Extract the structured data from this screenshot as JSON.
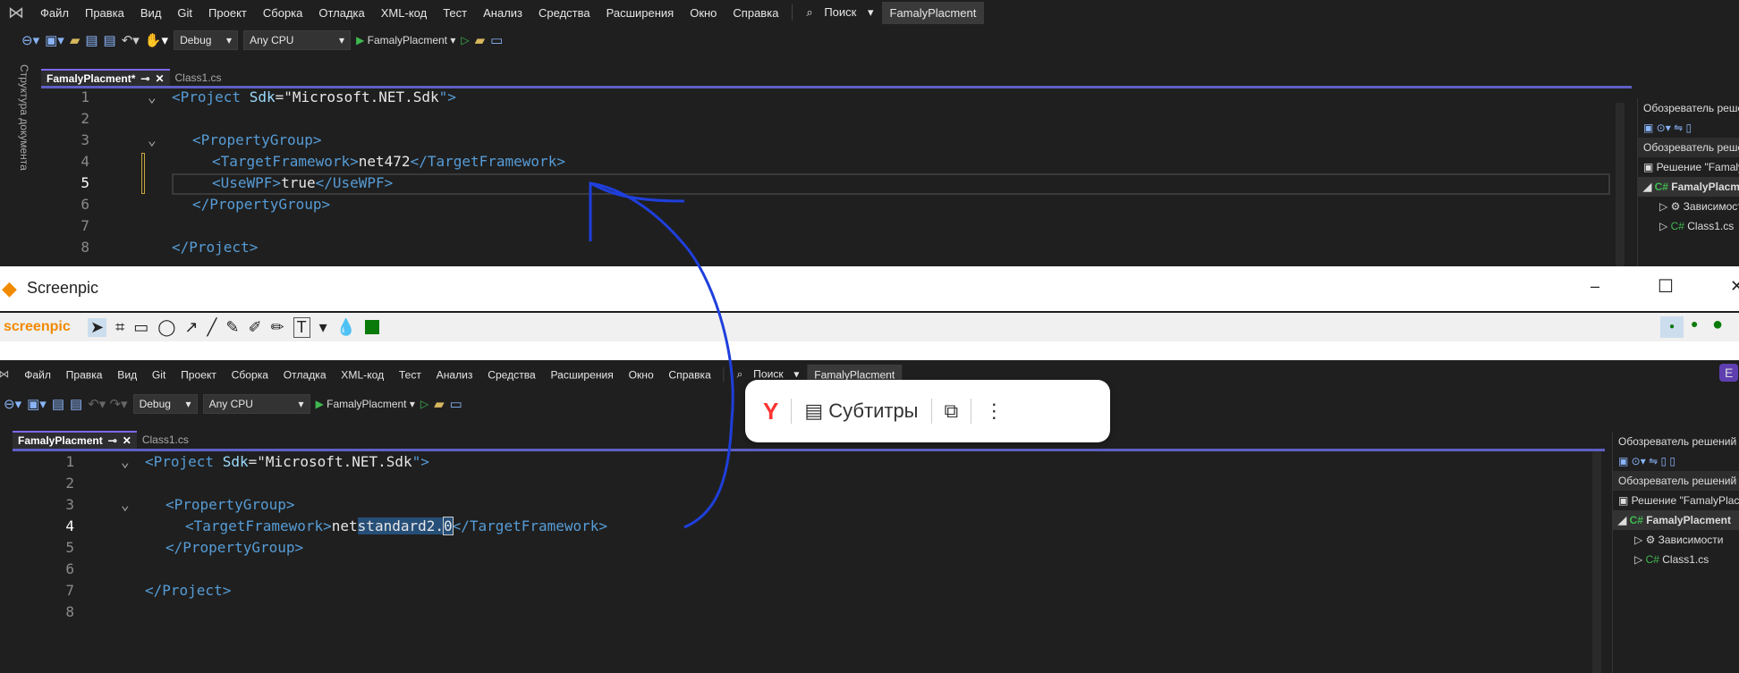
{
  "vs_top": {
    "menu": [
      "Файл",
      "Правка",
      "Вид",
      "Git",
      "Проект",
      "Сборка",
      "Отладка",
      "XML-код",
      "Тест",
      "Анализ",
      "Средства",
      "Расширения",
      "Окно",
      "Справка"
    ],
    "search": "Поиск",
    "project_badge": "FamalyPlacment",
    "config": "Debug",
    "platform": "Any CPU",
    "run_target": "FamalyPlacment",
    "tabs": [
      "FamalyPlacment*",
      "Class1.cs"
    ],
    "doc_outline": "Структура документа",
    "lines": [
      "1",
      "2",
      "3",
      "4",
      "5",
      "6",
      "7",
      "8"
    ],
    "code": {
      "l1a": "<Project ",
      "l1b": "Sdk",
      "l1c": "=\"",
      "l1d": "Microsoft.NET.Sdk",
      "l1e": "\">",
      "l3": "<PropertyGroup>",
      "l4a": "<TargetFramework>",
      "l4b": "net472",
      "l4c": "</TargetFramework>",
      "l5a": "<UseWPF>",
      "l5b": "true",
      "l5c": "</UseWPF>",
      "l6": "</PropertyGroup>",
      "l8": "</Project>"
    },
    "solution": {
      "title": "Обозреватель решений",
      "search": "Обозреватель решений",
      "solution": "Решение \"FamalyPlacment\"",
      "project": "FamalyPlacment",
      "deps": "Зависимости",
      "file": "Class1.cs"
    }
  },
  "screenpic": {
    "title": "Screenpic",
    "logo": "screenpic",
    "minimize": "–",
    "maximize": "☐",
    "close": "✕"
  },
  "popup": {
    "subtitles": "Субтитры"
  },
  "vs_bottom": {
    "tabs": [
      "FamalyPlacment",
      "Class1.cs"
    ],
    "lines": [
      "1",
      "2",
      "3",
      "4",
      "5",
      "6",
      "7",
      "8"
    ],
    "code": {
      "l4b1": "net",
      "l4b2": "standard2.",
      "l4b3": "0"
    },
    "solution_letter": "E"
  },
  "colors": {
    "accent": "#5f5fc4",
    "annotation": "#1f3fdc"
  }
}
